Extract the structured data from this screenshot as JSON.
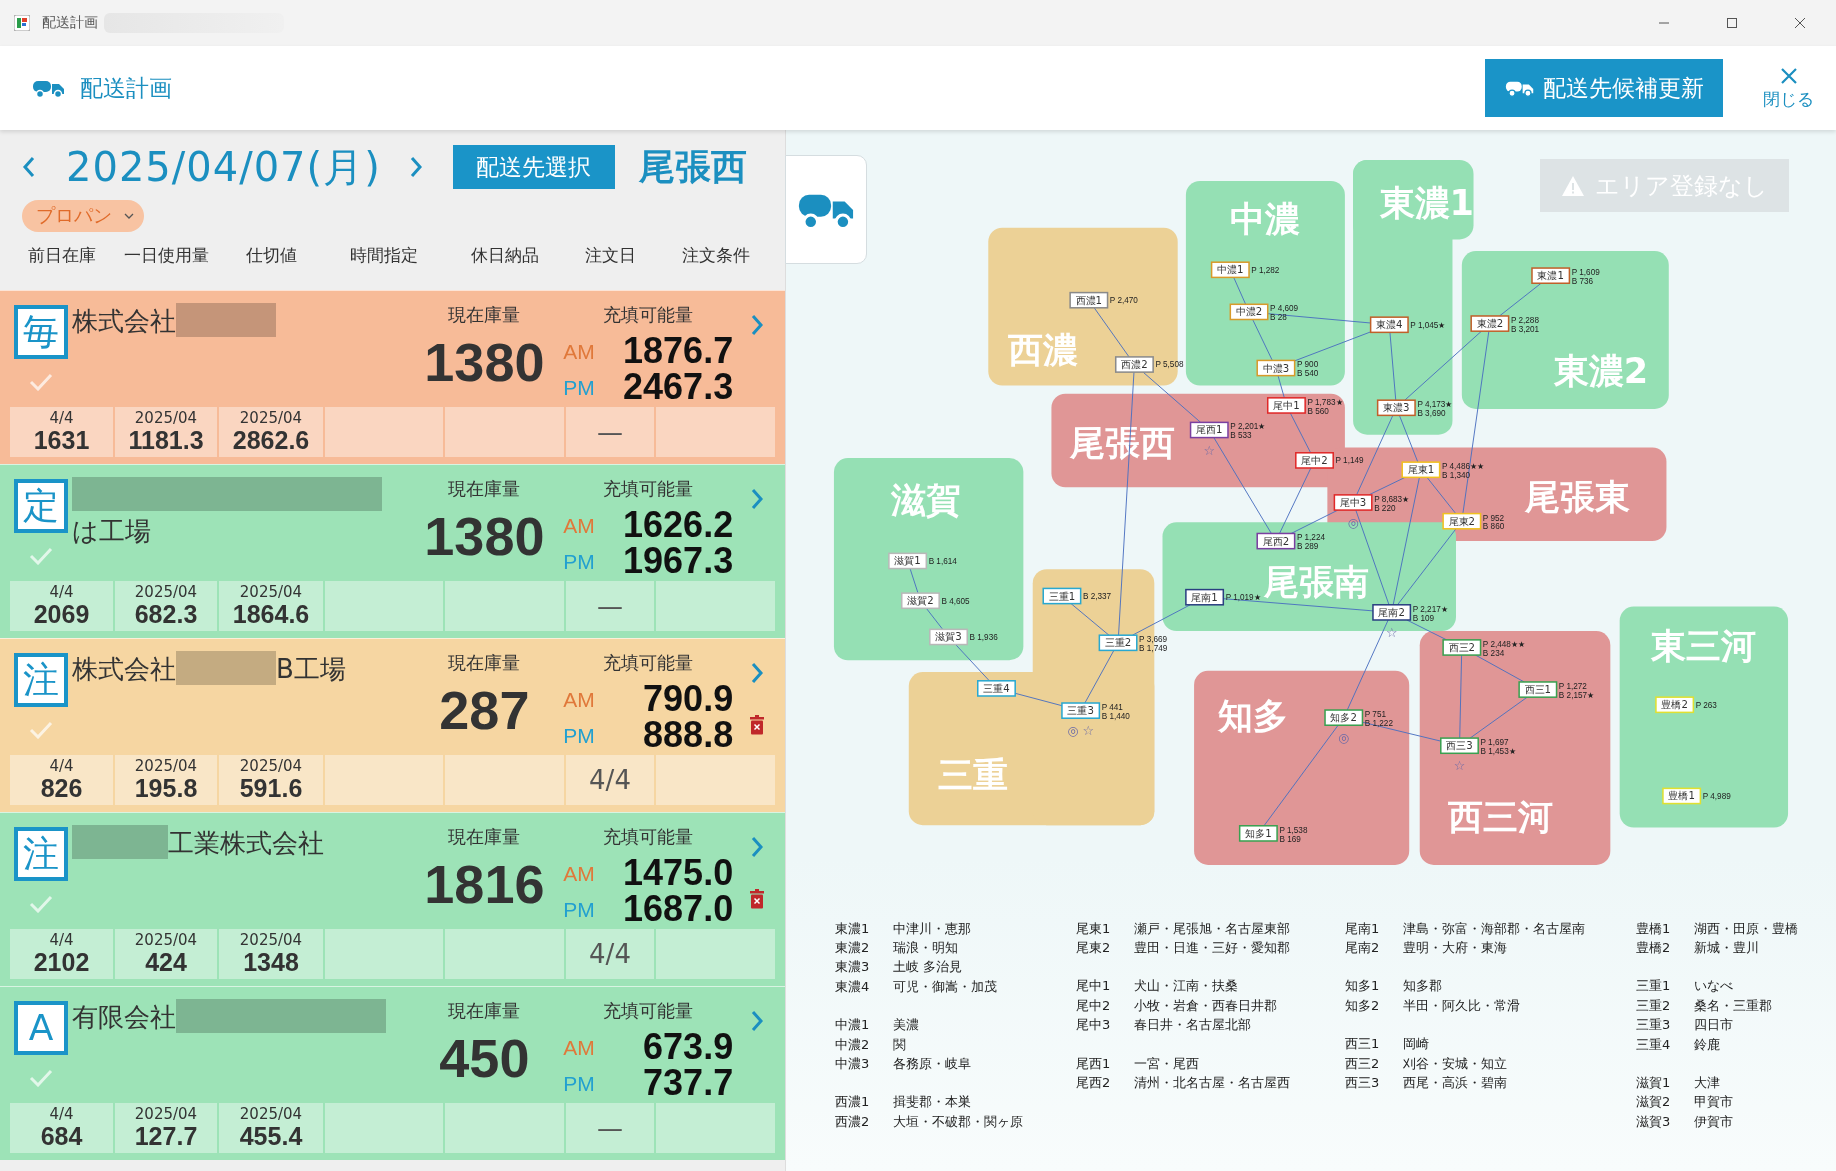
{
  "window": {
    "title": "配送計画"
  },
  "header": {
    "title": "配送計画",
    "update_button": "配送先候補更新",
    "close_label": "閉じる"
  },
  "date_bar": {
    "date": "2025/04/07(月)",
    "select_button": "配送先選択",
    "area": "尾張西"
  },
  "product_filter": {
    "value": "プロパン"
  },
  "columns": [
    "前日在庫",
    "一日使用量",
    "仕切値",
    "時間指定",
    "休日納品",
    "注文日",
    "注文条件"
  ],
  "customers": [
    {
      "badge": "毎",
      "color": "#f7bb98",
      "name_parts": [
        {
          "kind": "text",
          "text": "株式会社"
        },
        {
          "kind": "redacted"
        }
      ],
      "stock_label": "現在庫量",
      "stock": "1380",
      "fill_label": "充填可能量",
      "am_label": "AM",
      "am": "1876.7",
      "pm_label": "PM",
      "pm": "2467.3",
      "deletable": false,
      "stats": [
        {
          "top": "4/4",
          "value": "1631"
        },
        {
          "top": "2025/04",
          "value": "1181.3"
        },
        {
          "top": "2025/04",
          "value": "2862.6"
        }
      ],
      "order_date": "—"
    },
    {
      "badge": "定",
      "color": "#9de3b7",
      "name_parts": [
        {
          "kind": "redacted"
        },
        {
          "kind": "break"
        },
        {
          "kind": "text",
          "text": "は工場"
        }
      ],
      "stock_label": "現在庫量",
      "stock": "1380",
      "fill_label": "充填可能量",
      "am_label": "AM",
      "am": "1626.2",
      "pm_label": "PM",
      "pm": "1967.3",
      "deletable": false,
      "stats": [
        {
          "top": "4/4",
          "value": "2069"
        },
        {
          "top": "2025/04",
          "value": "682.3"
        },
        {
          "top": "2025/04",
          "value": "1864.6"
        }
      ],
      "order_date": "—"
    },
    {
      "badge": "注",
      "color": "#f6d6a2",
      "name_parts": [
        {
          "kind": "text",
          "text": "株式会社"
        },
        {
          "kind": "redacted"
        },
        {
          "kind": "text",
          "text": "B工場"
        }
      ],
      "stock_label": "現在庫量",
      "stock": "287",
      "fill_label": "充填可能量",
      "am_label": "AM",
      "am": "790.9",
      "pm_label": "PM",
      "pm": "888.8",
      "deletable": true,
      "stats": [
        {
          "top": "4/4",
          "value": "826"
        },
        {
          "top": "2025/04",
          "value": "195.8"
        },
        {
          "top": "2025/04",
          "value": "591.6"
        }
      ],
      "order_date": "4/4"
    },
    {
      "badge": "注",
      "color": "#9de3b7",
      "name_parts": [
        {
          "kind": "redacted"
        },
        {
          "kind": "text",
          "text": "工業株式会社"
        }
      ],
      "stock_label": "現在庫量",
      "stock": "1816",
      "fill_label": "充填可能量",
      "am_label": "AM",
      "am": "1475.0",
      "pm_label": "PM",
      "pm": "1687.0",
      "deletable": true,
      "stats": [
        {
          "top": "4/4",
          "value": "2102"
        },
        {
          "top": "2025/04",
          "value": "424"
        },
        {
          "top": "2025/04",
          "value": "1348"
        }
      ],
      "order_date": "4/4"
    },
    {
      "badge": "A",
      "color": "#9de3b7",
      "name_parts": [
        {
          "kind": "text",
          "text": "有限会社"
        },
        {
          "kind": "redacted"
        }
      ],
      "stock_label": "現在庫量",
      "stock": "450",
      "fill_label": "充填可能量",
      "am_label": "AM",
      "am": "673.9",
      "pm_label": "PM",
      "pm": "737.7",
      "deletable": false,
      "stats": [
        {
          "top": "4/4",
          "value": "684"
        },
        {
          "top": "2025/04",
          "value": "127.7"
        },
        {
          "top": "2025/04",
          "value": "455.4"
        }
      ],
      "order_date": "—"
    }
  ],
  "map": {
    "notice": "エリア登録なし",
    "regions": [
      {
        "name": "西濃",
        "color": "#ecd196"
      },
      {
        "name": "中濃",
        "color": "#95e0b4"
      },
      {
        "name": "東濃1",
        "color": "#95e0b4"
      },
      {
        "name": "東濃2",
        "color": "#95e0b4"
      },
      {
        "name": "尾張西",
        "color": "#e09696"
      },
      {
        "name": "尾張東",
        "color": "#e09696"
      },
      {
        "name": "滋賀",
        "color": "#95e0b4"
      },
      {
        "name": "尾張南",
        "color": "#95e0b4"
      },
      {
        "name": "三重",
        "color": "#ecd196"
      },
      {
        "name": "知多",
        "color": "#e09696"
      },
      {
        "name": "西三河",
        "color": "#e09696"
      },
      {
        "name": "東三河",
        "color": "#95e0b4"
      }
    ],
    "nodes": [
      {
        "label": "中濃1",
        "color": "#d89a2a",
        "readings": [
          "P 1,282"
        ]
      },
      {
        "label": "東濃1",
        "color": "#c0602a",
        "readings": [
          "P 1,609",
          "B 736"
        ]
      },
      {
        "label": "西濃1",
        "color": "#8a8a8a",
        "readings": [
          "P 2,470"
        ]
      },
      {
        "label": "中濃2",
        "color": "#d89a2a",
        "readings": [
          "P 4,609",
          "B 28"
        ]
      },
      {
        "label": "東濃4",
        "color": "#c0602a",
        "readings": [
          "P 1,045★"
        ]
      },
      {
        "label": "東濃2",
        "color": "#c0602a",
        "readings": [
          "P 2,288",
          "B 3,201"
        ]
      },
      {
        "label": "西濃2",
        "color": "#8a8a8a",
        "readings": [
          "P 5,508"
        ]
      },
      {
        "label": "中濃3",
        "color": "#d89a2a",
        "readings": [
          "P 900",
          "B 540"
        ]
      },
      {
        "label": "尾中1",
        "color": "#e02828",
        "readings": [
          "P 1,783★",
          "B 560"
        ]
      },
      {
        "label": "東濃3",
        "color": "#c0602a",
        "readings": [
          "P 4,173★",
          "B 3,690"
        ]
      },
      {
        "label": "尾西1",
        "color": "#7a3fa0",
        "readings": [
          "P 2,201★",
          "B 533"
        ],
        "marks": "☆"
      },
      {
        "label": "尾中2",
        "color": "#e02828",
        "readings": [
          "P 1,149"
        ]
      },
      {
        "label": "尾東1",
        "color": "#f0c020",
        "readings": [
          "P 4,486★★",
          "B 1,340"
        ]
      },
      {
        "label": "尾中3",
        "color": "#e02828",
        "readings": [
          "P 8,683★",
          "B 220"
        ],
        "marks": "◎"
      },
      {
        "label": "尾東2",
        "color": "#f0c020",
        "readings": [
          "P 952",
          "B 860"
        ]
      },
      {
        "label": "尾西2",
        "color": "#7a3fa0",
        "readings": [
          "P 1,224",
          "B 289"
        ]
      },
      {
        "label": "滋賀1",
        "color": "#b8b8b8",
        "readings": [
          "B 1,614"
        ]
      },
      {
        "label": "滋賀2",
        "color": "#b8b8b8",
        "readings": [
          "B 4,605"
        ]
      },
      {
        "label": "三重1",
        "color": "#29a8d0",
        "readings": [
          "B 2,337"
        ]
      },
      {
        "label": "尾南1",
        "color": "#2a3f80",
        "readings": [
          "P 1,019★"
        ]
      },
      {
        "label": "尾南2",
        "color": "#2a3f80",
        "readings": [
          "P 2,217★",
          "B 109"
        ],
        "marks": "☆"
      },
      {
        "label": "滋賀3",
        "color": "#b8b8b8",
        "readings": [
          "B 1,936"
        ]
      },
      {
        "label": "三重2",
        "color": "#29a8d0",
        "readings": [
          "P 3,669",
          "B 1,749"
        ]
      },
      {
        "label": "西三2",
        "color": "#3aa050",
        "readings": [
          "P 2,448★★",
          "B 234"
        ]
      },
      {
        "label": "三重4",
        "color": "#29a8d0"
      },
      {
        "label": "西三1",
        "color": "#3aa050",
        "readings": [
          "P 1,272",
          "B 2,157★"
        ]
      },
      {
        "label": "三重3",
        "color": "#29a8d0",
        "readings": [
          "P 441",
          "B 1,440"
        ],
        "marks": "◎ ☆"
      },
      {
        "label": "知多2",
        "color": "#3aa050",
        "readings": [
          "P 751",
          "B 1,222"
        ],
        "marks": "◎"
      },
      {
        "label": "豊橋2",
        "color": "#e0e030",
        "readings": [
          "P 263"
        ]
      },
      {
        "label": "西三3",
        "color": "#3aa050",
        "readings": [
          "P 1,697",
          "B 1,453★"
        ],
        "marks": "☆"
      },
      {
        "label": "豊橋1",
        "color": "#e0e030",
        "readings": [
          "P 4,989"
        ]
      },
      {
        "label": "知多1",
        "color": "#3aa050",
        "readings": [
          "P 1,538",
          "B 169"
        ]
      }
    ],
    "legend": [
      [
        [
          {
            "code": "東濃1",
            "name": "中津川・恵那"
          },
          {
            "code": "東濃2",
            "name": "瑞浪・明知"
          },
          {
            "code": "東濃3",
            "name": "土岐 多治見"
          },
          {
            "code": "東濃4",
            "name": "可児・御嵩・加茂"
          }
        ],
        [
          {
            "code": "中濃1",
            "name": "美濃"
          },
          {
            "code": "中濃2",
            "name": "関"
          },
          {
            "code": "中濃3",
            "name": "各務原・岐阜"
          }
        ],
        [
          {
            "code": "西濃1",
            "name": "揖斐郡・本巣"
          },
          {
            "code": "西濃2",
            "name": "大垣・不破郡・関ヶ原"
          }
        ]
      ],
      [
        [
          {
            "code": "尾東1",
            "name": "瀬戸・尾張旭・名古屋東部"
          },
          {
            "code": "尾東2",
            "name": "豊田・日進・三好・愛知郡"
          }
        ],
        [
          {
            "code": "尾中1",
            "name": "犬山・江南・扶桑"
          },
          {
            "code": "尾中2",
            "name": "小牧・岩倉・西春日井郡"
          },
          {
            "code": "尾中3",
            "name": "春日井・名古屋北部"
          }
        ],
        [
          {
            "code": "尾西1",
            "name": "一宮・尾西"
          },
          {
            "code": "尾西2",
            "name": "清州・北名古屋・名古屋西"
          }
        ]
      ],
      [
        [
          {
            "code": "尾南1",
            "name": "津島・弥富・海部郡・名古屋南"
          },
          {
            "code": "尾南2",
            "name": "豊明・大府・東海"
          }
        ],
        [
          {
            "code": "知多1",
            "name": "知多郡"
          },
          {
            "code": "知多2",
            "name": "半田・阿久比・常滑"
          }
        ],
        [
          {
            "code": "西三1",
            "name": "岡崎"
          },
          {
            "code": "西三2",
            "name": "刈谷・安城・知立"
          },
          {
            "code": "西三3",
            "name": "西尾・高浜・碧南"
          }
        ]
      ],
      [
        [
          {
            "code": "豊橋1",
            "name": "湖西・田原・豊橋"
          },
          {
            "code": "豊橋2",
            "name": "新城・豊川"
          }
        ],
        [
          {
            "code": "三重1",
            "name": "いなべ"
          },
          {
            "code": "三重2",
            "name": "桑名・三重郡"
          },
          {
            "code": "三重3",
            "name": "四日市"
          },
          {
            "code": "三重4",
            "name": "鈴鹿"
          }
        ],
        [
          {
            "code": "滋賀1",
            "name": "大津"
          },
          {
            "code": "滋賀2",
            "name": "甲賀市"
          },
          {
            "code": "滋賀3",
            "name": "伊賀市"
          }
        ]
      ]
    ]
  }
}
